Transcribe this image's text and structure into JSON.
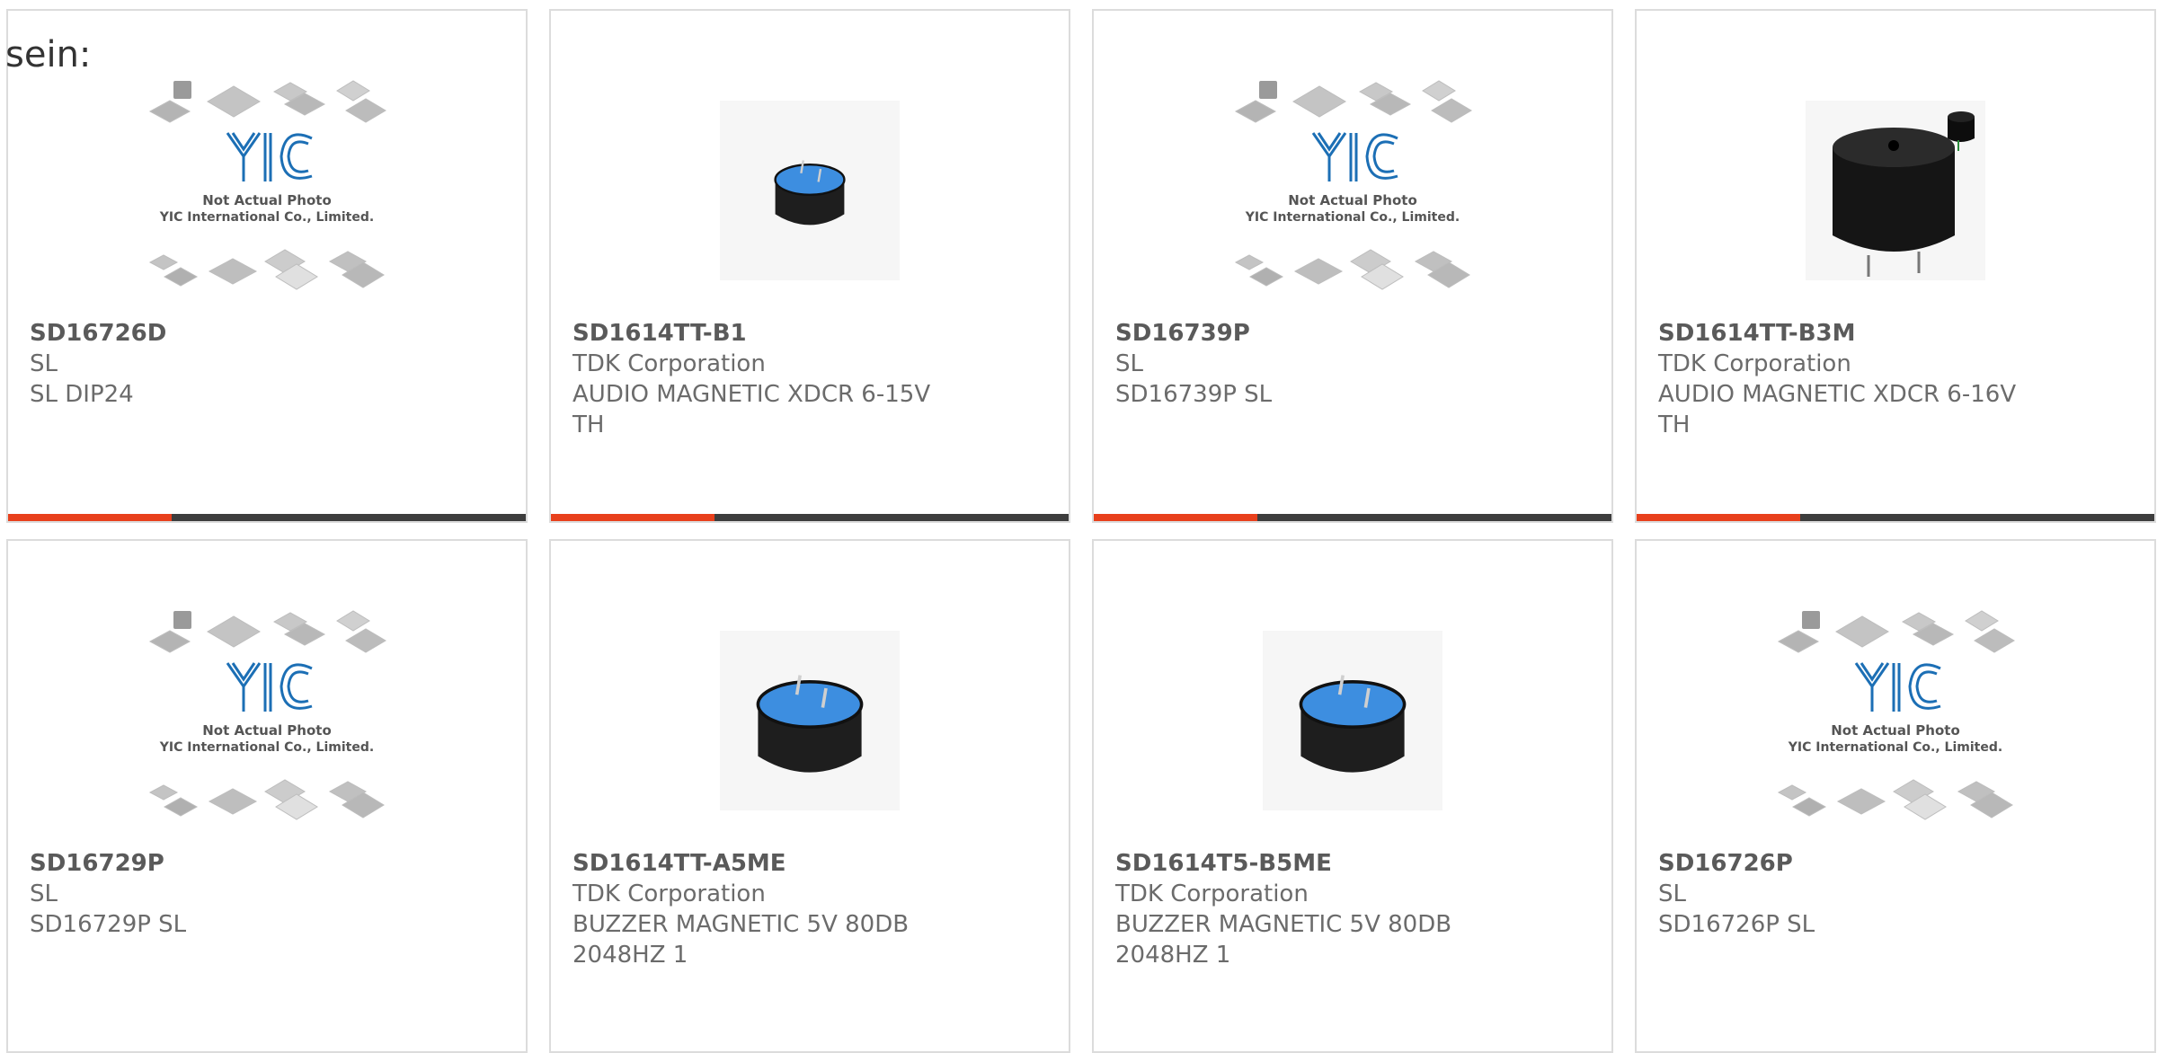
{
  "intro_text": "sein:",
  "placeholder": {
    "brand": "YIC",
    "line1": "Not Actual Photo",
    "line2": "YIC International Co., Limited."
  },
  "colors": {
    "accent": "#e8401c",
    "bar": "#3d3d3d",
    "brand_blue": "#1c6fb5",
    "buzzer_blue": "#3d8ee0"
  },
  "products": [
    {
      "part_number": "SD16726D",
      "manufacturer": "SL",
      "description": "SL DIP24",
      "image": "placeholder"
    },
    {
      "part_number": "SD1614TT-B1",
      "manufacturer": "TDK Corporation",
      "description": "AUDIO MAGNETIC XDCR 6-15V\nTH",
      "image": "buzzer-small"
    },
    {
      "part_number": "SD16739P",
      "manufacturer": "SL",
      "description": "SD16739P SL",
      "image": "placeholder"
    },
    {
      "part_number": "SD1614TT-B3M",
      "manufacturer": "TDK Corporation",
      "description": "AUDIO MAGNETIC XDCR 6-16V\nTH",
      "image": "buzzer-black"
    },
    {
      "part_number": "SD16729P",
      "manufacturer": "SL",
      "description": "SD16729P SL",
      "image": "placeholder"
    },
    {
      "part_number": "SD1614TT-A5ME",
      "manufacturer": "TDK Corporation",
      "description": "BUZZER MAGNETIC 5V 80DB\n2048HZ 1",
      "image": "buzzer-large"
    },
    {
      "part_number": "SD1614T5-B5ME",
      "manufacturer": "TDK Corporation",
      "description": "BUZZER MAGNETIC 5V 80DB\n2048HZ 1",
      "image": "buzzer-large"
    },
    {
      "part_number": "SD16726P",
      "manufacturer": "SL",
      "description": "SD16726P SL",
      "image": "placeholder"
    }
  ]
}
